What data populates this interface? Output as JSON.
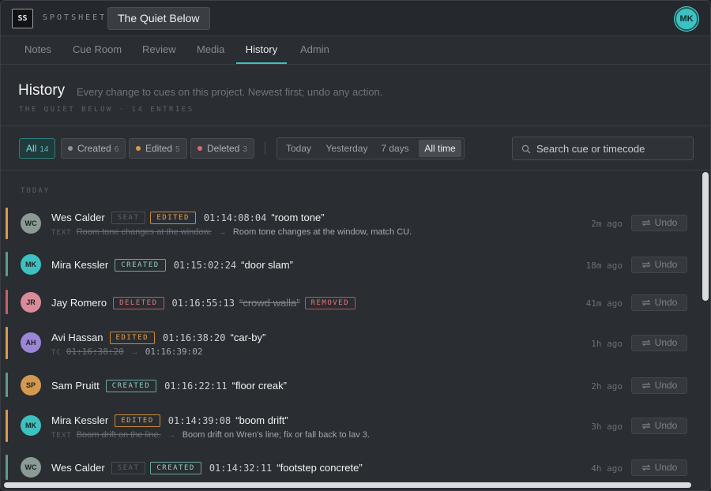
{
  "app": {
    "logo": "SS",
    "brand": "SPOTSHEET",
    "project": "The Quiet Below",
    "user_initials": "MK"
  },
  "tabs": [
    {
      "label": "Notes"
    },
    {
      "label": "Cue Room"
    },
    {
      "label": "Review"
    },
    {
      "label": "Media"
    },
    {
      "label": "History",
      "active": true
    },
    {
      "label": "Admin"
    }
  ],
  "header": {
    "title": "History",
    "subtitle": "Every change to cues on this project. Newest first; undo any action.",
    "meta": "THE QUIET BELOW · 14 ENTRIES"
  },
  "filters": {
    "chips": [
      {
        "label": "All",
        "count": "14",
        "active": true
      },
      {
        "label": "Created",
        "count": "6",
        "dot": "#8a9a95"
      },
      {
        "label": "Edited",
        "count": "5",
        "dot": "#d99a4e"
      },
      {
        "label": "Deleted",
        "count": "3",
        "dot": "#d86a70"
      }
    ],
    "ranges": [
      "Today",
      "Yesterday",
      "7 days",
      "All time"
    ],
    "active_range": "All time",
    "search_placeholder": "Search cue or timecode"
  },
  "colors": {
    "accent": "#3ec1c1",
    "edited": "#d99a4e",
    "created": "#5f9a8e",
    "deleted": "#c66266"
  },
  "list": {
    "group": "TODAY",
    "undo_label": "Undo",
    "entries": [
      {
        "initials": "WC",
        "user": "Wes Calder",
        "seat": "SEAT",
        "action": "EDITED",
        "timecode": "01:14:08:04",
        "cue": "“room tone”",
        "detail_label": "TEXT",
        "old": "Room tone changes at the window.",
        "new": "Room tone changes at the window, match CU.",
        "ago": "2m ago"
      },
      {
        "initials": "MK",
        "user": "Mira Kessler",
        "action": "CREATED",
        "timecode": "01:15:02:24",
        "cue": "“door slam”",
        "ago": "18m ago"
      },
      {
        "initials": "JR",
        "user": "Jay Romero",
        "action": "DELETED",
        "timecode": "01:16:55:13",
        "cue": "“crowd walla”",
        "removed": "REMOVED",
        "ago": "41m ago"
      },
      {
        "initials": "AH",
        "user": "Avi Hassan",
        "action": "EDITED",
        "timecode": "01:16:38:20",
        "cue": "“car-by”",
        "detail_label": "TC",
        "old": "01:16:38:20",
        "new": "01:16:39:02",
        "ago": "1h ago"
      },
      {
        "initials": "SP",
        "user": "Sam Pruitt",
        "action": "CREATED",
        "timecode": "01:16:22:11",
        "cue": "“floor creak”",
        "ago": "2h ago"
      },
      {
        "initials": "MK",
        "user": "Mira Kessler",
        "action": "EDITED",
        "timecode": "01:14:39:08",
        "cue": "“boom drift”",
        "detail_label": "TEXT",
        "old": "Boom drift on the line.",
        "new": "Boom drift on Wren's line; fix or fall back to lav 3.",
        "ago": "3h ago"
      },
      {
        "initials": "WC",
        "user": "Wes Calder",
        "seat": "SEAT",
        "action": "CREATED",
        "timecode": "01:14:32:11",
        "cue": "“footstep concrete”",
        "ago": "4h ago"
      }
    ]
  }
}
